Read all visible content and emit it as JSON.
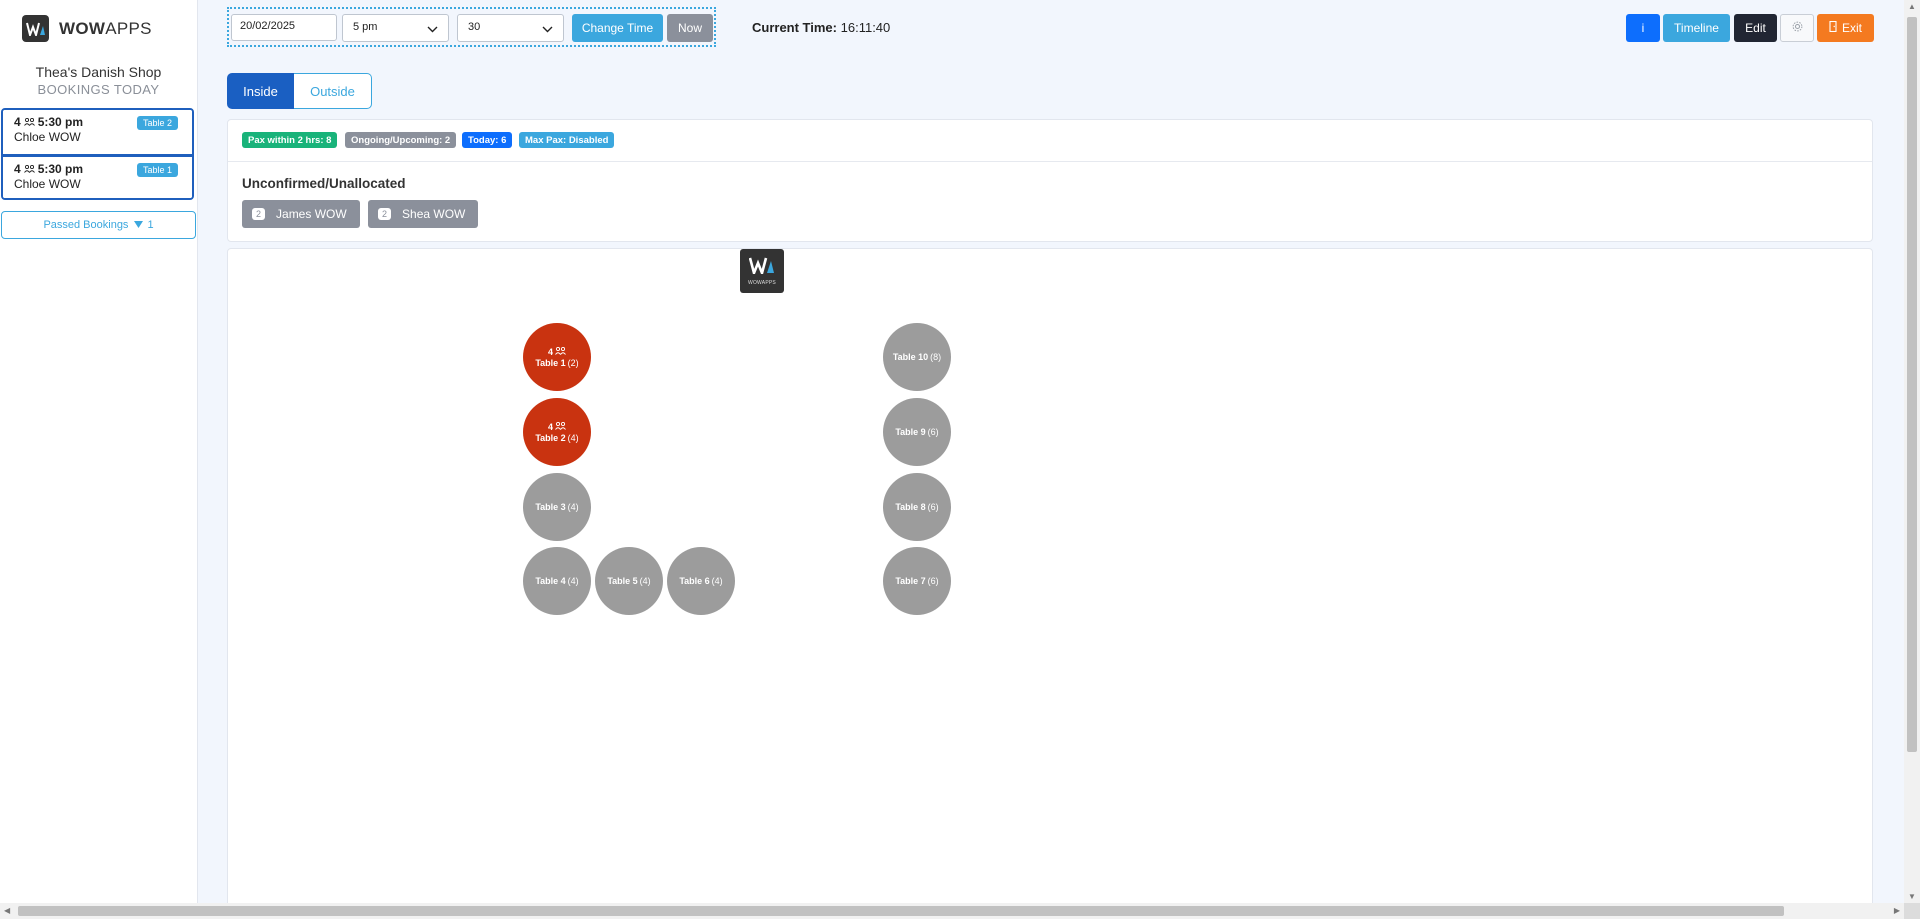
{
  "brand": {
    "name_bold": "WOW",
    "name_rest": "APPS"
  },
  "sidebar": {
    "shop_name": "Thea's Danish Shop",
    "section_title": "BOOKINGS TODAY",
    "bookings": [
      {
        "pax": "4",
        "time": "5:30 pm",
        "name": "Chloe WOW",
        "table": "Table 2"
      },
      {
        "pax": "4",
        "time": "5:30 pm",
        "name": "Chloe WOW",
        "table": "Table 1"
      }
    ],
    "passed_label": "Passed Bookings",
    "passed_count": "1"
  },
  "toolbar": {
    "date": "20/02/2025",
    "hour_select": "5 pm",
    "minute_select": "30",
    "change_time": "Change Time",
    "now": "Now",
    "current_time_label": "Current Time:",
    "current_time_value": "16:11:40",
    "info": "i",
    "timeline": "Timeline",
    "edit": "Edit",
    "exit": "Exit"
  },
  "tabs": {
    "inside": "Inside",
    "outside": "Outside"
  },
  "stats": {
    "pax_2hrs": "Pax within 2 hrs: 8",
    "ongoing": "Ongoing/Upcoming: 2",
    "today": "Today: 6",
    "max_pax": "Max Pax: Disabled"
  },
  "unconfirmed": {
    "title": "Unconfirmed/Unallocated",
    "items": [
      {
        "count": "2",
        "name": "James WOW"
      },
      {
        "count": "2",
        "name": "Shea WOW"
      }
    ]
  },
  "floor": {
    "logo_text": "WOWAPPS",
    "tables": [
      {
        "name": "Table 1",
        "cap": "(2)",
        "pax": "4",
        "status": "busy"
      },
      {
        "name": "Table 2",
        "cap": "(4)",
        "pax": "4",
        "status": "busy"
      },
      {
        "name": "Table 3",
        "cap": "(4)",
        "pax": "",
        "status": "free"
      },
      {
        "name": "Table 4",
        "cap": "(4)",
        "pax": "",
        "status": "free"
      },
      {
        "name": "Table 5",
        "cap": "(4)",
        "pax": "",
        "status": "free"
      },
      {
        "name": "Table 6",
        "cap": "(4)",
        "pax": "",
        "status": "free"
      },
      {
        "name": "Table 7",
        "cap": "(6)",
        "pax": "",
        "status": "free"
      },
      {
        "name": "Table 8",
        "cap": "(6)",
        "pax": "",
        "status": "free"
      },
      {
        "name": "Table 9",
        "cap": "(6)",
        "pax": "",
        "status": "free"
      },
      {
        "name": "Table 10",
        "cap": "(8)",
        "pax": "",
        "status": "free"
      }
    ]
  },
  "colors": {
    "primary": "#1a5fc2",
    "info": "#3ba7de",
    "busy_table": "#c93310",
    "free_table": "#9c9c9c",
    "exit": "#f47a20",
    "success": "#19b37a"
  }
}
